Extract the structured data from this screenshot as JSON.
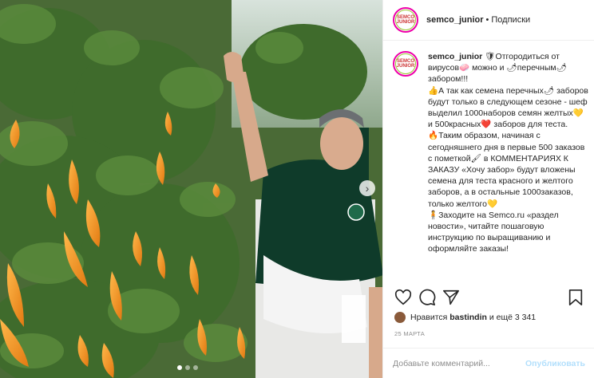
{
  "post": {
    "author": {
      "username": "semco_junior",
      "separator": "•",
      "follow_label": "Подписки",
      "avatar_text": "SEMCO JUNIOR"
    },
    "caption": {
      "username": "semco_junior",
      "text": " 🛡Отгородиться от вирусов🧼 можно и 🌶перечным🌶 забором!!!\n👍А так как семена перечных🌶 заборов будут только в следующем сезоне - шеф выделил 1000наборов семян желтых💛 и 500красных❤️ заборов для теста.\n🔥Таким образом, начиная с сегодняшнего дня в первые 500 заказов с пометкой🖌 в КОММЕНТАРИЯХ К ЗАКАЗУ «Хочу забор» будут вложены семена для теста красного и желтого заборов, а в остальные 1000заказов, только желтого💛\n🧍Заходите на Semco.ru «раздел новости», читайте пошаговую инструкцию по выращиванию и оформляйте заказы!"
    },
    "actions": {
      "like_icon": "heart-icon",
      "comment_icon": "comment-icon",
      "share_icon": "share-icon",
      "save_icon": "bookmark-icon"
    },
    "likes": {
      "prefix": "Нравится ",
      "user": "bastindin",
      "suffix": " и ещё 3 341"
    },
    "date": "25 МАРТА",
    "comment": {
      "placeholder": "Добавьте комментарий...",
      "publish_label": "Опубликовать"
    },
    "carousel": {
      "next_glyph": "›",
      "slide_count": 3,
      "active_slide": 1
    },
    "colors": {
      "publish_disabled": "#b2dffc",
      "muted": "#8e8e8e",
      "text": "#262626"
    }
  }
}
